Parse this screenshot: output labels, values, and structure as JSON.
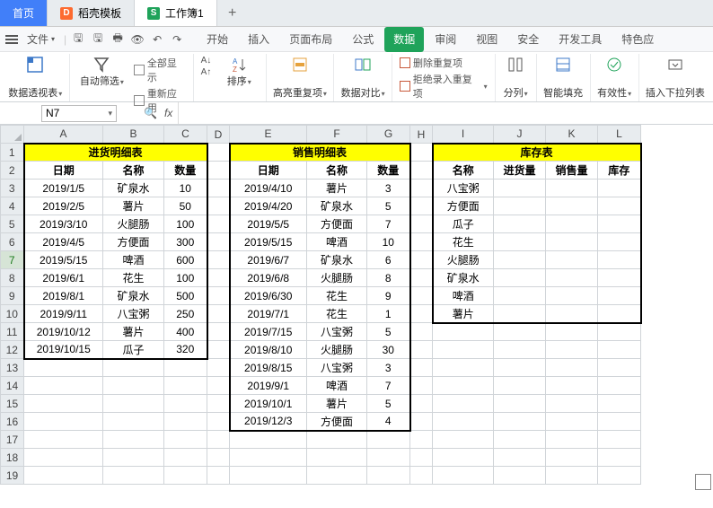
{
  "tabs": {
    "home": "首页",
    "dao": "稻壳模板",
    "xls": "工作簿1"
  },
  "file_menu": "文件",
  "menu": [
    "开始",
    "插入",
    "页面布局",
    "公式",
    "数据",
    "审阅",
    "视图",
    "安全",
    "开发工具",
    "特色应"
  ],
  "active_menu": 4,
  "ribbon": {
    "pivot": "数据透视表",
    "filter": "自动筛选",
    "show_all": "全部显示",
    "reapply": "重新应用",
    "sort": "排序",
    "hl_dup": "高亮重复项",
    "data_cmp": "数据对比",
    "del_dup": "删除重复项",
    "reject_dup": "拒绝录入重复项",
    "split": "分列",
    "smart_fill": "智能填充",
    "validity": "有效性",
    "dropdown": "插入下拉列表"
  },
  "namebox": "N7",
  "cols": [
    "A",
    "B",
    "C",
    "D",
    "E",
    "F",
    "G",
    "H",
    "I",
    "J",
    "K",
    "L"
  ],
  "t1": {
    "title": "进货明细表",
    "h": [
      "日期",
      "名称",
      "数量"
    ],
    "rows": [
      [
        "2019/1/5",
        "矿泉水",
        "10"
      ],
      [
        "2019/2/5",
        "薯片",
        "50"
      ],
      [
        "2019/3/10",
        "火腿肠",
        "100"
      ],
      [
        "2019/4/5",
        "方便面",
        "300"
      ],
      [
        "2019/5/15",
        "啤酒",
        "600"
      ],
      [
        "2019/6/1",
        "花生",
        "100"
      ],
      [
        "2019/8/1",
        "矿泉水",
        "500"
      ],
      [
        "2019/9/11",
        "八宝粥",
        "250"
      ],
      [
        "2019/10/12",
        "薯片",
        "400"
      ],
      [
        "2019/10/15",
        "瓜子",
        "320"
      ]
    ]
  },
  "t2": {
    "title": "销售明细表",
    "h": [
      "日期",
      "名称",
      "数量"
    ],
    "rows": [
      [
        "2019/4/10",
        "薯片",
        "3"
      ],
      [
        "2019/4/20",
        "矿泉水",
        "5"
      ],
      [
        "2019/5/5",
        "方便面",
        "7"
      ],
      [
        "2019/5/15",
        "啤酒",
        "10"
      ],
      [
        "2019/6/7",
        "矿泉水",
        "6"
      ],
      [
        "2019/6/8",
        "火腿肠",
        "8"
      ],
      [
        "2019/6/30",
        "花生",
        "9"
      ],
      [
        "2019/7/1",
        "花生",
        "1"
      ],
      [
        "2019/7/15",
        "八宝粥",
        "5"
      ],
      [
        "2019/8/10",
        "火腿肠",
        "30"
      ],
      [
        "2019/8/15",
        "八宝粥",
        "3"
      ],
      [
        "2019/9/1",
        "啤酒",
        "7"
      ],
      [
        "2019/10/1",
        "薯片",
        "5"
      ],
      [
        "2019/12/3",
        "方便面",
        "4"
      ]
    ]
  },
  "t3": {
    "title": "库存表",
    "h": [
      "名称",
      "进货量",
      "销售量",
      "库存"
    ],
    "rows": [
      "八宝粥",
      "方便面",
      "瓜子",
      "花生",
      "火腿肠",
      "矿泉水",
      "啤酒",
      "薯片"
    ]
  }
}
